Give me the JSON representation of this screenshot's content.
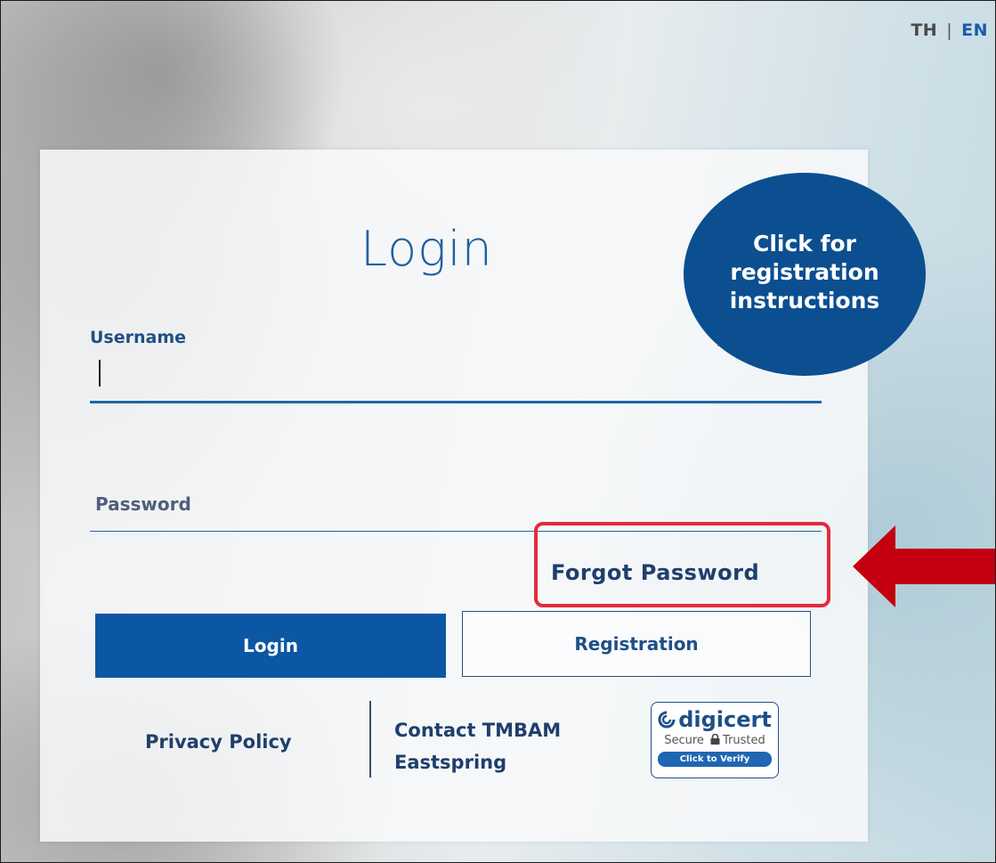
{
  "language": {
    "th": "TH",
    "separator": "|",
    "en": "EN",
    "active": "EN"
  },
  "login_card": {
    "title": "Login",
    "registration_bubble": "Click for\nregistration\ninstructions",
    "username_label": "Username",
    "username_value": "",
    "password_label": "Password",
    "password_value": "",
    "forgot_password": "Forgot Password",
    "login_button": "Login",
    "registration_button": "Registration"
  },
  "footer": {
    "privacy_policy": "Privacy Policy",
    "contact_line1": "Contact TMBAM",
    "contact_line2": "Eastspring",
    "digicert": {
      "brand": "digicert",
      "secure": "Secure",
      "trusted": "Trusted",
      "verify": "Click to Verify"
    }
  },
  "annotation": {
    "highlight_color": "#e52b3b",
    "arrow_color": "#c40010"
  },
  "colors": {
    "primary": "#0b57a4",
    "bubble": "#0b4f91",
    "text_dark": "#1f3f6c"
  }
}
